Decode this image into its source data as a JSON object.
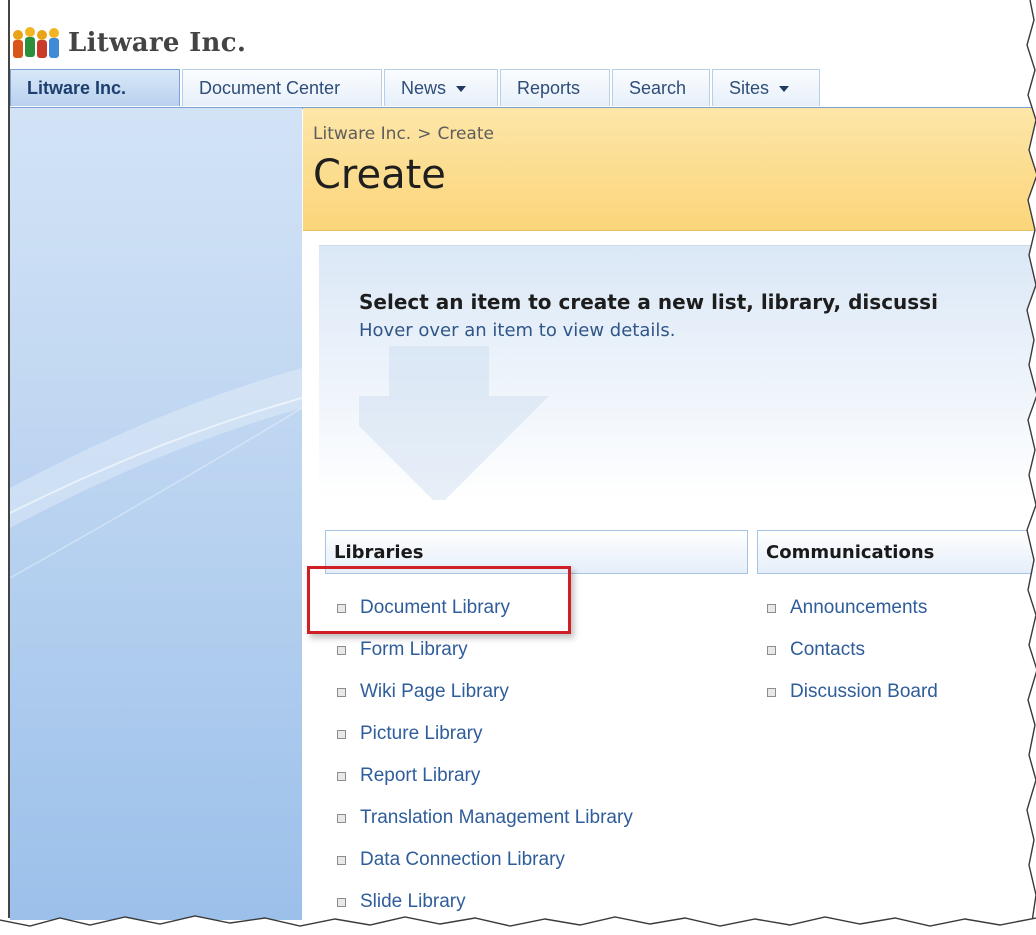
{
  "site": {
    "title": "Litware Inc."
  },
  "topnav": {
    "tabs": [
      {
        "label": "Litware Inc.",
        "selected": true,
        "dropdown": false
      },
      {
        "label": "Document Center",
        "selected": false,
        "dropdown": false
      },
      {
        "label": "News",
        "selected": false,
        "dropdown": true
      },
      {
        "label": "Reports",
        "selected": false,
        "dropdown": false
      },
      {
        "label": "Search",
        "selected": false,
        "dropdown": false
      },
      {
        "label": "Sites",
        "selected": false,
        "dropdown": true
      }
    ]
  },
  "breadcrumb": {
    "root": "Litware Inc.",
    "separator": ">",
    "current": "Create"
  },
  "page": {
    "title": "Create",
    "heading": "Select an item to create a new list, library, discussi",
    "subheading": "Hover over an item to view details."
  },
  "sections": {
    "libraries": {
      "title": "Libraries",
      "items": [
        "Document Library",
        "Form Library",
        "Wiki Page Library",
        "Picture Library",
        "Report Library",
        "Translation Management Library",
        "Data Connection Library",
        "Slide Library"
      ]
    },
    "communications": {
      "title": "Communications",
      "items": [
        "Announcements",
        "Contacts",
        "Discussion Board"
      ]
    }
  },
  "colors": {
    "tab_border": "#7aa3d4",
    "title_band": "#fbd57a",
    "link": "#2f5d9b",
    "highlight": "#cf1f25"
  }
}
